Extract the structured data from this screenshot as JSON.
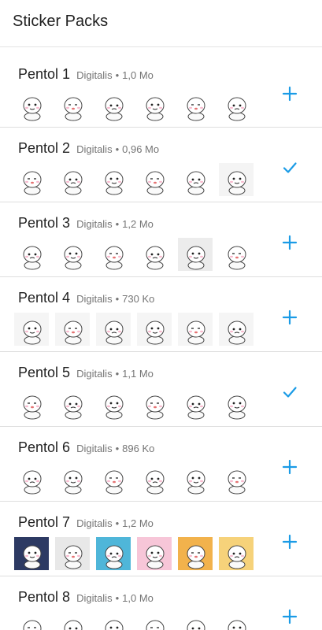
{
  "app": {
    "title": "Sticker Packs"
  },
  "colors": {
    "accent": "#1a9be6",
    "divider": "#dedede",
    "meta": "#757575"
  },
  "packs": [
    {
      "name": "Pentol 1",
      "publisher": "Digitalis",
      "size": "1,0 Mo",
      "status": "add",
      "icon": "plus-icon",
      "sticker_bgs": [
        "#ffffff",
        "#ffffff",
        "#ffffff",
        "#ffffff",
        "#ffffff",
        "#ffffff"
      ]
    },
    {
      "name": "Pentol 2",
      "publisher": "Digitalis",
      "size": "0,96 Mo",
      "status": "added",
      "icon": "check-icon",
      "sticker_bgs": [
        "#ffffff",
        "#ffffff",
        "#ffffff",
        "#ffffff",
        "#ffffff",
        "#f4f4f4"
      ]
    },
    {
      "name": "Pentol 3",
      "publisher": "Digitalis",
      "size": "1,2 Mo",
      "status": "add",
      "icon": "plus-icon",
      "sticker_bgs": [
        "#ffffff",
        "#ffffff",
        "#ffffff",
        "#ffffff",
        "#ececec",
        "#ffffff"
      ]
    },
    {
      "name": "Pentol 4",
      "publisher": "Digitalis",
      "size": "730 Ko",
      "status": "add",
      "icon": "plus-icon",
      "sticker_bgs": [
        "#f5f5f5",
        "#f5f5f5",
        "#f5f5f5",
        "#f5f5f5",
        "#f5f5f5",
        "#f5f5f5"
      ]
    },
    {
      "name": "Pentol 5",
      "publisher": "Digitalis",
      "size": "1,1 Mo",
      "status": "added",
      "icon": "check-icon",
      "sticker_bgs": [
        "#ffffff",
        "#ffffff",
        "#ffffff",
        "#ffffff",
        "#ffffff",
        "#ffffff"
      ]
    },
    {
      "name": "Pentol 6",
      "publisher": "Digitalis",
      "size": "896 Ko",
      "status": "add",
      "icon": "plus-icon",
      "sticker_bgs": [
        "#ffffff",
        "#ffffff",
        "#ffffff",
        "#ffffff",
        "#ffffff",
        "#ffffff"
      ]
    },
    {
      "name": "Pentol 7",
      "publisher": "Digitalis",
      "size": "1,2 Mo",
      "status": "add",
      "icon": "plus-icon",
      "sticker_bgs": [
        "#2d3a63",
        "#e8e8e8",
        "#4fb6d9",
        "#f7c6d8",
        "#f2b24c",
        "#f6d27a"
      ]
    },
    {
      "name": "Pentol 8",
      "publisher": "Digitalis",
      "size": "1,0 Mo",
      "status": "add",
      "icon": "plus-icon",
      "sticker_bgs": [
        "#ffffff",
        "#ffffff",
        "#ffffff",
        "#ffffff",
        "#ffffff",
        "#ffffff"
      ]
    }
  ]
}
